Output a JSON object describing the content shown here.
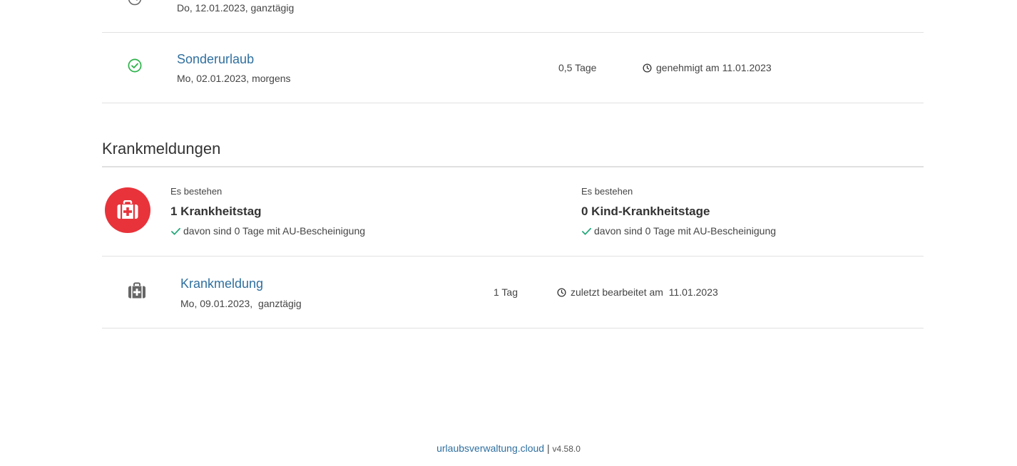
{
  "applications": [
    {
      "type": "",
      "date": "Do, 12.01.2023, ganztägig",
      "duration": "",
      "status": "",
      "status_icon": "clock-outline-icon"
    },
    {
      "type": "Sonderurlaub",
      "date": "Mo, 02.01.2023, morgens",
      "duration": "0,5 Tage",
      "status": "genehmigt am 11.01.2023",
      "status_icon": "check-circle-icon"
    }
  ],
  "sick_notes": {
    "heading": "Krankmeldungen",
    "summary": {
      "sick_days": {
        "prefix": "Es bestehen",
        "value": "1 Krankheitstag",
        "note": "davon sind 0 Tage mit AU-Bescheinigung"
      },
      "child_sick_days": {
        "prefix": "Es bestehen",
        "value": "0 Kind-Krankheitstage",
        "note": "davon sind 0 Tage mit AU-Bescheinigung"
      }
    },
    "entries": [
      {
        "title": "Krankmeldung",
        "date": "Mo, 09.01.2023,  ganztägig",
        "duration": "1 Tag",
        "status": "zuletzt bearbeitet am  11.01.2023"
      }
    ]
  },
  "footer": {
    "link": "urlaubsverwaltung.cloud",
    "separator": "|",
    "version": "v4.58.0"
  },
  "colors": {
    "link": "#2f6f9f",
    "approved_green": "#2db24a",
    "sick_red": "#e8333b",
    "check_green": "#1fa67a"
  }
}
